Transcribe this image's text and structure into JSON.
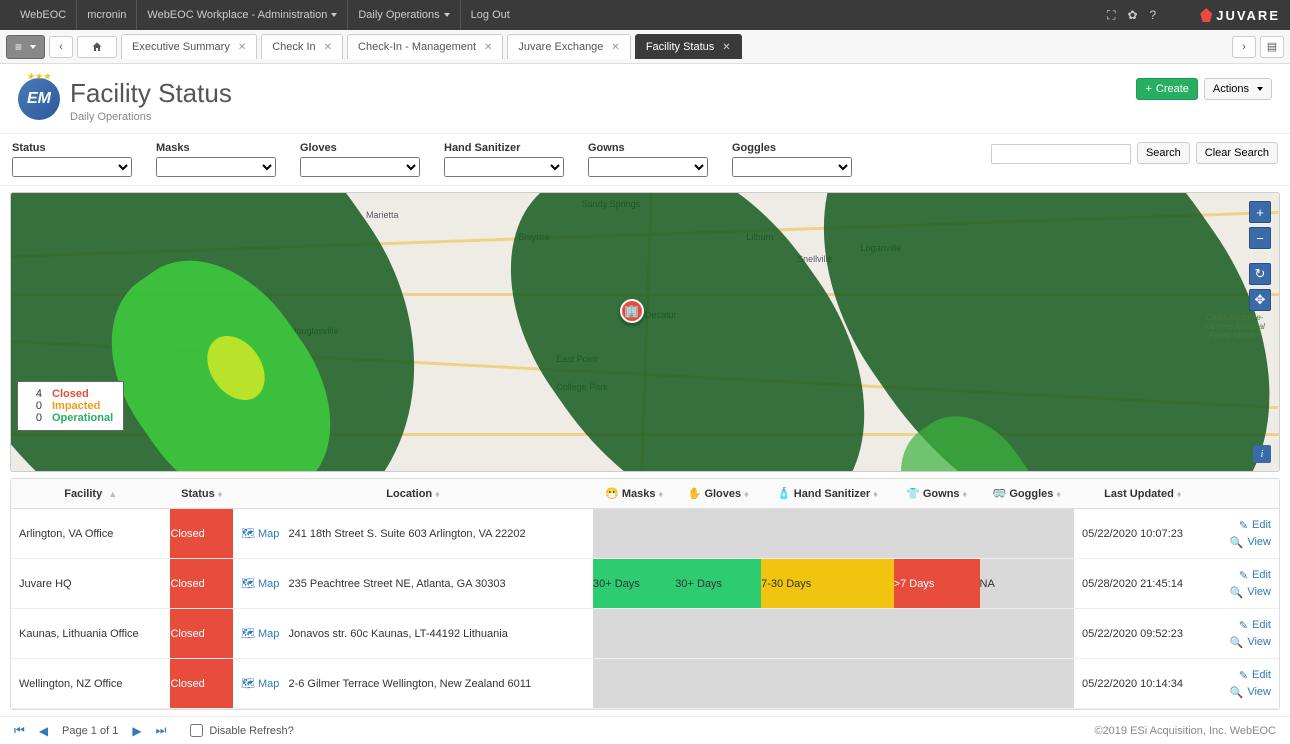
{
  "topbar": {
    "app": "WebEOC",
    "user": "mcronin",
    "menu1": "WebEOC Workplace - Administration",
    "menu2": "Daily Operations",
    "logout": "Log Out",
    "brand": "JUVARE"
  },
  "tabs": [
    {
      "label": "Executive Summary",
      "active": false
    },
    {
      "label": "Check In",
      "active": false
    },
    {
      "label": "Check-In - Management",
      "active": false
    },
    {
      "label": "Juvare Exchange",
      "active": false
    },
    {
      "label": "Facility Status",
      "active": true
    }
  ],
  "page": {
    "title": "Facility Status",
    "subtitle": "Daily Operations",
    "create": "Create",
    "actions": "Actions"
  },
  "filters": {
    "f1": "Status",
    "f2": "Masks",
    "f3": "Gloves",
    "f4": "Hand Sanitizer",
    "f5": "Gowns",
    "f6": "Goggles",
    "search": "Search",
    "clear": "Clear Search"
  },
  "legend": {
    "closed_n": "4",
    "closed": "Closed",
    "impacted_n": "0",
    "impacted": "Impacted",
    "operational_n": "0",
    "operational": "Operational"
  },
  "map_cities": {
    "c1": "Sandy Springs",
    "c2": "Smyrna",
    "c3": "Decatur",
    "c4": "East Point",
    "c5": "Marietta",
    "c6": "College Park",
    "c7": "Douglasville",
    "c8": "Lilburn",
    "c9": "Snellville",
    "c10": "Loganville",
    "park": "Chattahoochee-Oconee National Forest (district)"
  },
  "columns": {
    "facility": "Facility",
    "status": "Status",
    "location": "Location",
    "masks": "Masks",
    "gloves": "Gloves",
    "sanitizer": "Hand Sanitizer",
    "gowns": "Gowns",
    "goggles": "Goggles",
    "updated": "Last Updated"
  },
  "supply_labels": {
    "green": "30+ Days",
    "yellow": "7-30 Days",
    "red": ">7 Days",
    "na": "NA"
  },
  "row_labels": {
    "map": "Map",
    "edit": "Edit",
    "view": "View"
  },
  "rows": [
    {
      "facility": "Arlington, VA Office",
      "status": "Closed",
      "addr": "241 18th Street S. Suite 603 Arlington, VA 22202",
      "updated": "05/22/2020 10:07:23",
      "supplies": null
    },
    {
      "facility": "Juvare HQ",
      "status": "Closed",
      "addr": "235 Peachtree Street NE, Atlanta, GA 30303",
      "updated": "05/28/2020 21:45:14",
      "supplies": {
        "masks": "green",
        "gloves": "green",
        "sanitizer": "yellow",
        "gowns": "red",
        "goggles": "na"
      }
    },
    {
      "facility": "Kaunas, Lithuania Office",
      "status": "Closed",
      "addr": "Jonavos str. 60c Kaunas, LT-44192 Lithuania",
      "updated": "05/22/2020 09:52:23",
      "supplies": null
    },
    {
      "facility": "Wellington, NZ Office",
      "status": "Closed",
      "addr": "2-6 Gilmer Terrace Wellington, New Zealand 6011",
      "updated": "05/22/2020 10:14:34",
      "supplies": null
    }
  ],
  "footer": {
    "page": "Page 1 of 1",
    "disable": "Disable Refresh?",
    "copy": "©2019 ESi Acquisition, Inc. WebEOC"
  }
}
